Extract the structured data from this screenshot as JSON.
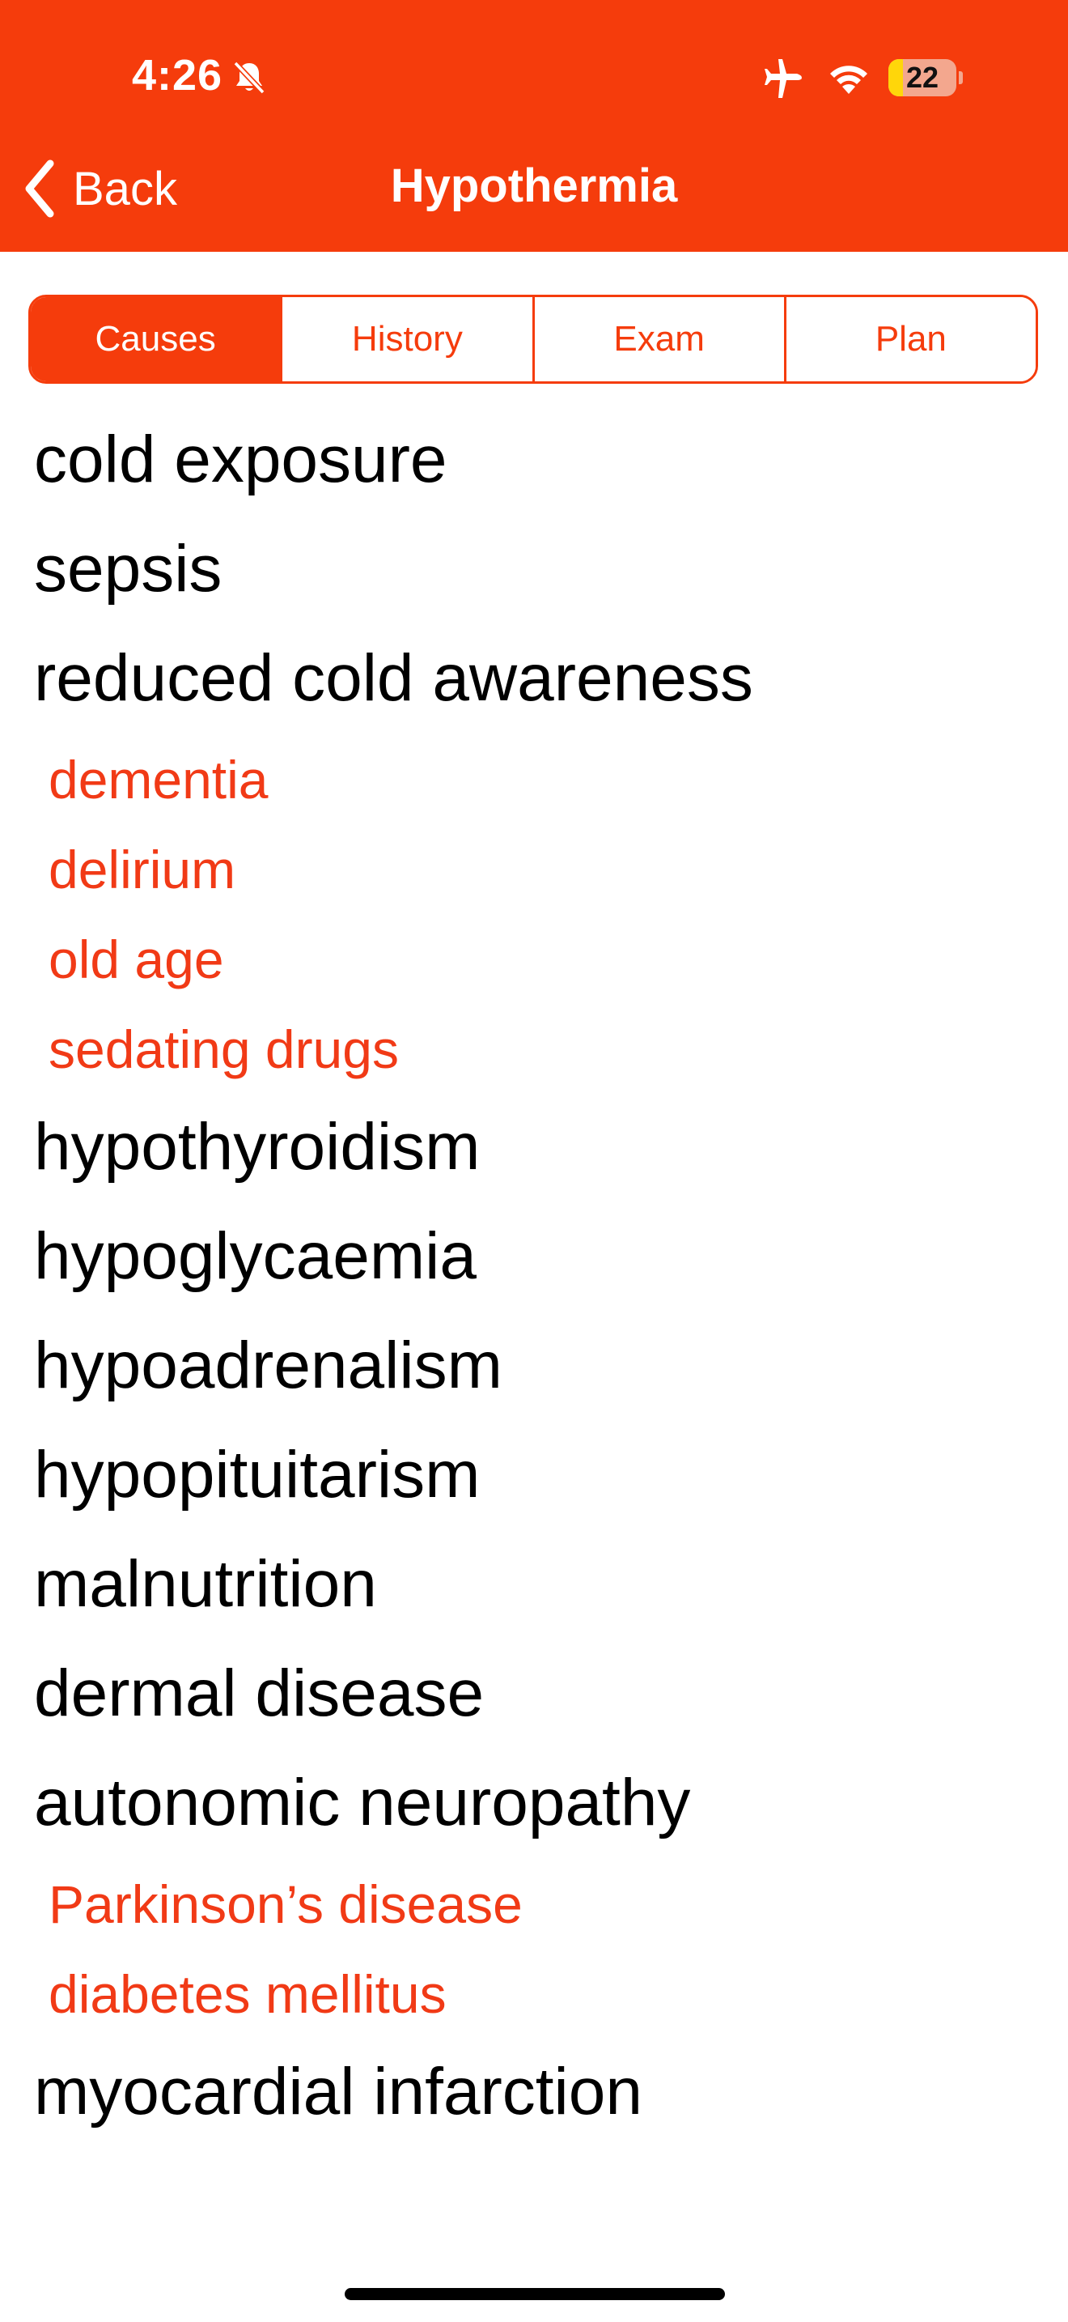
{
  "status_bar": {
    "time": "4:26",
    "battery_level": "22",
    "battery_fraction": 0.22,
    "icons": [
      "bell-slash-icon",
      "airplane-icon",
      "wifi-icon",
      "battery-icon"
    ]
  },
  "nav": {
    "back_label": "Back",
    "title": "Hypothermia"
  },
  "tabs": [
    {
      "label": "Causes",
      "active": true
    },
    {
      "label": "History",
      "active": false
    },
    {
      "label": "Exam",
      "active": false
    },
    {
      "label": "Plan",
      "active": false
    }
  ],
  "causes": [
    {
      "label": "cold exposure",
      "level": "primary"
    },
    {
      "label": "sepsis",
      "level": "primary"
    },
    {
      "label": "reduced cold awareness",
      "level": "primary"
    },
    {
      "label": "dementia",
      "level": "sub"
    },
    {
      "label": "delirium",
      "level": "sub"
    },
    {
      "label": "old age",
      "level": "sub"
    },
    {
      "label": "sedating drugs",
      "level": "sub"
    },
    {
      "label": "hypothyroidism",
      "level": "primary"
    },
    {
      "label": "hypoglycaemia",
      "level": "primary"
    },
    {
      "label": "hypoadrenalism",
      "level": "primary"
    },
    {
      "label": "hypopituitarism",
      "level": "primary"
    },
    {
      "label": "malnutrition",
      "level": "primary"
    },
    {
      "label": "dermal disease",
      "level": "primary"
    },
    {
      "label": "autonomic neuropathy",
      "level": "primary"
    },
    {
      "label": "Parkinson’s disease",
      "level": "sub"
    },
    {
      "label": "diabetes mellitus",
      "level": "sub"
    },
    {
      "label": "myocardial infarction",
      "level": "primary"
    }
  ],
  "colors": {
    "accent": "#F53C0C",
    "sub_item": "#F13A16",
    "primary_text": "#000000",
    "background": "#FFFFFF"
  }
}
